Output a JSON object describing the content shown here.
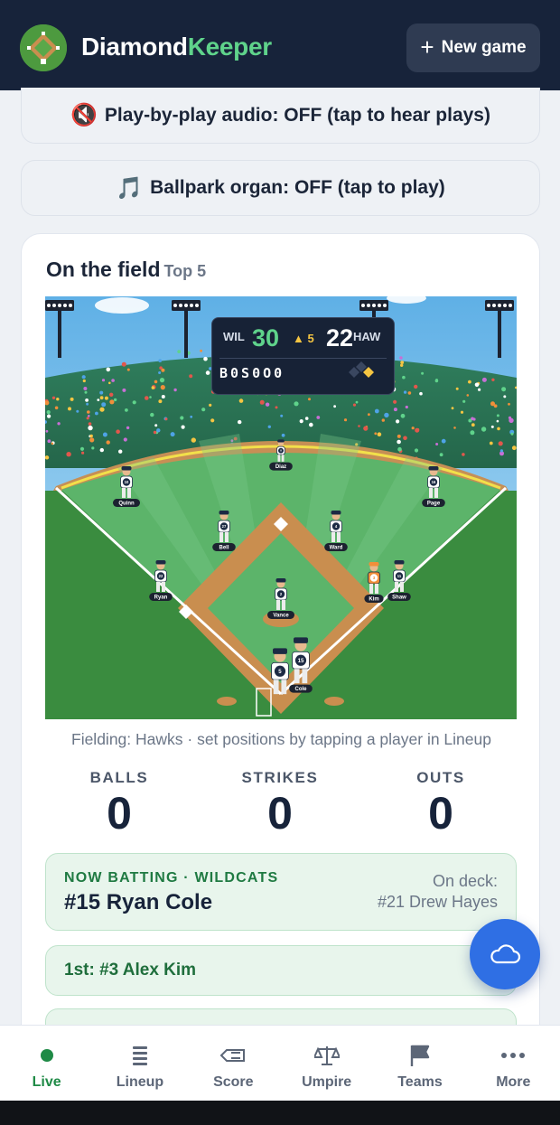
{
  "app": {
    "brand_primary": "Diamond",
    "brand_accent": "Keeper",
    "new_game_label": "New game"
  },
  "toggles": {
    "audio_label": "Play-by-play audio: OFF (tap to hear plays)",
    "audio_icon": "muted-speaker-icon",
    "organ_label": "Ballpark organ: OFF (tap to play)",
    "organ_icon": "music-notes-icon"
  },
  "field": {
    "title": "On the field",
    "inning_label": "Top 5",
    "note": "Fielding: Hawks · set positions by tapping a player in Lineup",
    "scoreboard": {
      "away_team": "WIL",
      "away_score": "30",
      "inning": "▲ 5",
      "home_score": "22",
      "home_team": "HAW",
      "count_text": "B0S0O0"
    },
    "players": [
      {
        "number": "8",
        "name": "Diaz"
      },
      {
        "number": "10",
        "name": "Quinn"
      },
      {
        "number": "16",
        "name": "Page"
      },
      {
        "number": "27",
        "name": "Bell"
      },
      {
        "number": "4",
        "name": "Ward"
      },
      {
        "number": "22",
        "name": "Ryan"
      },
      {
        "number": "2",
        "name": "Vance"
      },
      {
        "number": "3",
        "name": "Kim"
      },
      {
        "number": "11",
        "name": "Shaw"
      },
      {
        "number": "5",
        "name": ""
      },
      {
        "number": "15",
        "name": "Cole"
      }
    ]
  },
  "count": {
    "balls_label": "BALLS",
    "balls": "0",
    "strikes_label": "STRIKES",
    "strikes": "0",
    "outs_label": "OUTS",
    "outs": "0"
  },
  "batting": {
    "kicker": "NOW BATTING · WILDCATS",
    "batter": "#15 Ryan Cole",
    "ondeck_label": "On deck:",
    "ondeck": "#21 Drew Hayes"
  },
  "runners": {
    "first": "1st: #3 Alex Kim"
  },
  "nav": [
    {
      "label": "Live",
      "icon": "live-dot-icon",
      "active": true
    },
    {
      "label": "Lineup",
      "icon": "list-icon",
      "active": false
    },
    {
      "label": "Score",
      "icon": "pencil-icon",
      "active": false
    },
    {
      "label": "Umpire",
      "icon": "scales-icon",
      "active": false
    },
    {
      "label": "Teams",
      "icon": "flag-icon",
      "active": false
    },
    {
      "label": "More",
      "icon": "more-dots-icon",
      "active": false
    }
  ],
  "colors": {
    "header_bg": "#17233a",
    "accent_green": "#5fd38b",
    "active_nav": "#1f8a46",
    "fab_blue": "#2f6fe4"
  }
}
